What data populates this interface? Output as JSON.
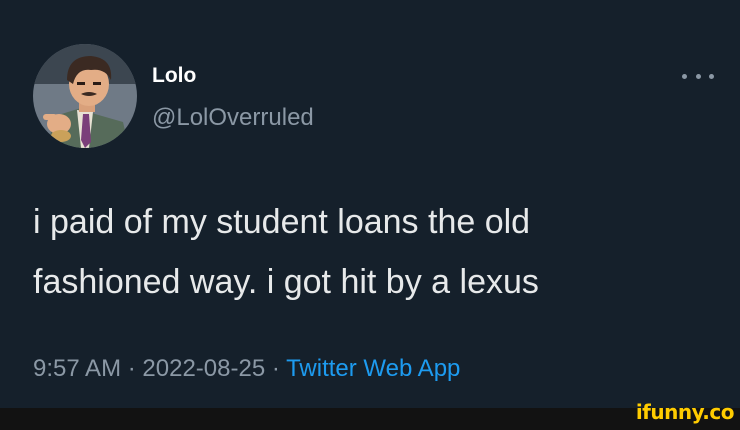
{
  "tweet": {
    "display_name": "Lolo",
    "handle": "@LolOverruled",
    "text_line1": "i paid of my student loans the old",
    "text_line2": "fashioned way. i got hit by a lexus",
    "time": "9:57 AM",
    "separator": "·",
    "date": "2022-08-25",
    "source": "Twitter Web App"
  },
  "watermark": "ifunny.co",
  "icons": {
    "more": "more-options-icon",
    "avatar": "avatar-image"
  },
  "colors": {
    "background": "#15202b",
    "text": "#e7e9ea",
    "muted": "#8b98a5",
    "link": "#1d9bf0",
    "watermark": "#ffcc00"
  }
}
